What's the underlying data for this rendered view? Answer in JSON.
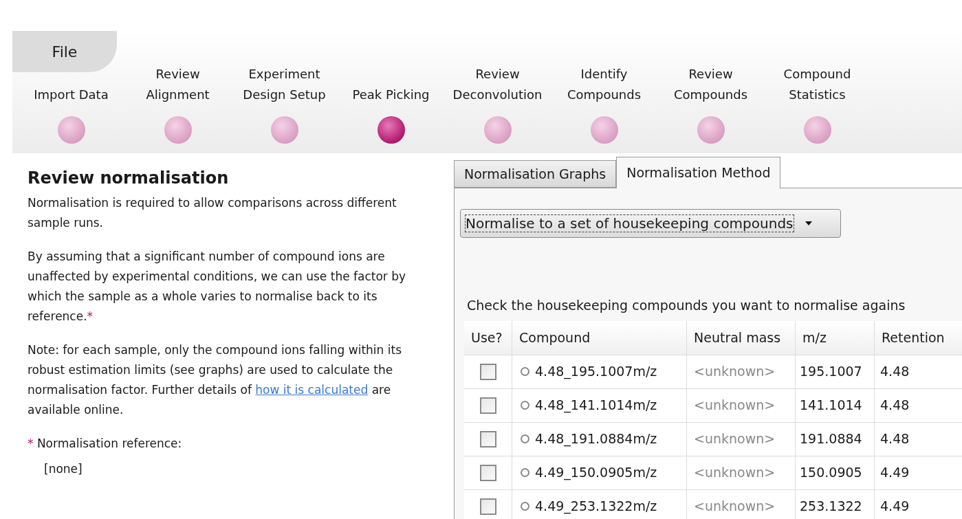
{
  "file_tab": "File",
  "steps": [
    {
      "lines": [
        "Import Data"
      ],
      "selected": false
    },
    {
      "lines": [
        "Review",
        "Alignment"
      ],
      "selected": false
    },
    {
      "lines": [
        "Experiment",
        "Design Setup"
      ],
      "selected": false
    },
    {
      "lines": [
        "Peak Picking"
      ],
      "selected": true
    },
    {
      "lines": [
        "Review",
        "Deconvolution"
      ],
      "selected": false
    },
    {
      "lines": [
        "Identify",
        "Compounds"
      ],
      "selected": false
    },
    {
      "lines": [
        "Review",
        "Compounds"
      ],
      "selected": false
    },
    {
      "lines": [
        "Compound",
        "Statistics"
      ],
      "selected": false
    }
  ],
  "left": {
    "heading": "Review normalisation",
    "para1": "Normalisation is required to allow comparisons across different sample runs.",
    "para2": {
      "text": "By assuming that a significant number of compound ions are unaffected by experimental conditions, we can use the factor by which the sample as a whole varies to normalise back to its reference.",
      "mark": "*"
    },
    "para3": {
      "before": "Note: for each sample, only the compound ions falling within its robust estimation limits (see graphs) are used to calculate the normalisation factor. Further details of",
      "link": "how it is calculated",
      "after": "are available online."
    },
    "reference": {
      "mark": "*",
      "label": "Normalisation reference:",
      "value": "[none]"
    }
  },
  "tabs": [
    {
      "label": "Normalisation Graphs",
      "selected": false
    },
    {
      "label": "Normalisation Method",
      "selected": true
    }
  ],
  "method_dropdown": {
    "value": "Normalise to a set of housekeeping compounds"
  },
  "instruction": "Check the housekeeping compounds you want to normalise agains",
  "table": {
    "columns": [
      "Use?",
      "Compound",
      "Neutral mass",
      "m/z",
      "Retention"
    ],
    "rows": [
      {
        "checked": false,
        "compound": "4.48_195.1007m/z",
        "neutral_mass": "<unknown>",
        "mz": "195.1007",
        "retention": "4.48"
      },
      {
        "checked": false,
        "compound": "4.48_141.1014m/z",
        "neutral_mass": "<unknown>",
        "mz": "141.1014",
        "retention": "4.48"
      },
      {
        "checked": false,
        "compound": "4.48_191.0884m/z",
        "neutral_mass": "<unknown>",
        "mz": "191.0884",
        "retention": "4.48"
      },
      {
        "checked": false,
        "compound": "4.49_150.0905m/z",
        "neutral_mass": "<unknown>",
        "mz": "150.0905",
        "retention": "4.49"
      },
      {
        "checked": false,
        "compound": "4.49_253.1322m/z",
        "neutral_mass": "<unknown>",
        "mz": "253.1322",
        "retention": "4.49"
      }
    ]
  }
}
